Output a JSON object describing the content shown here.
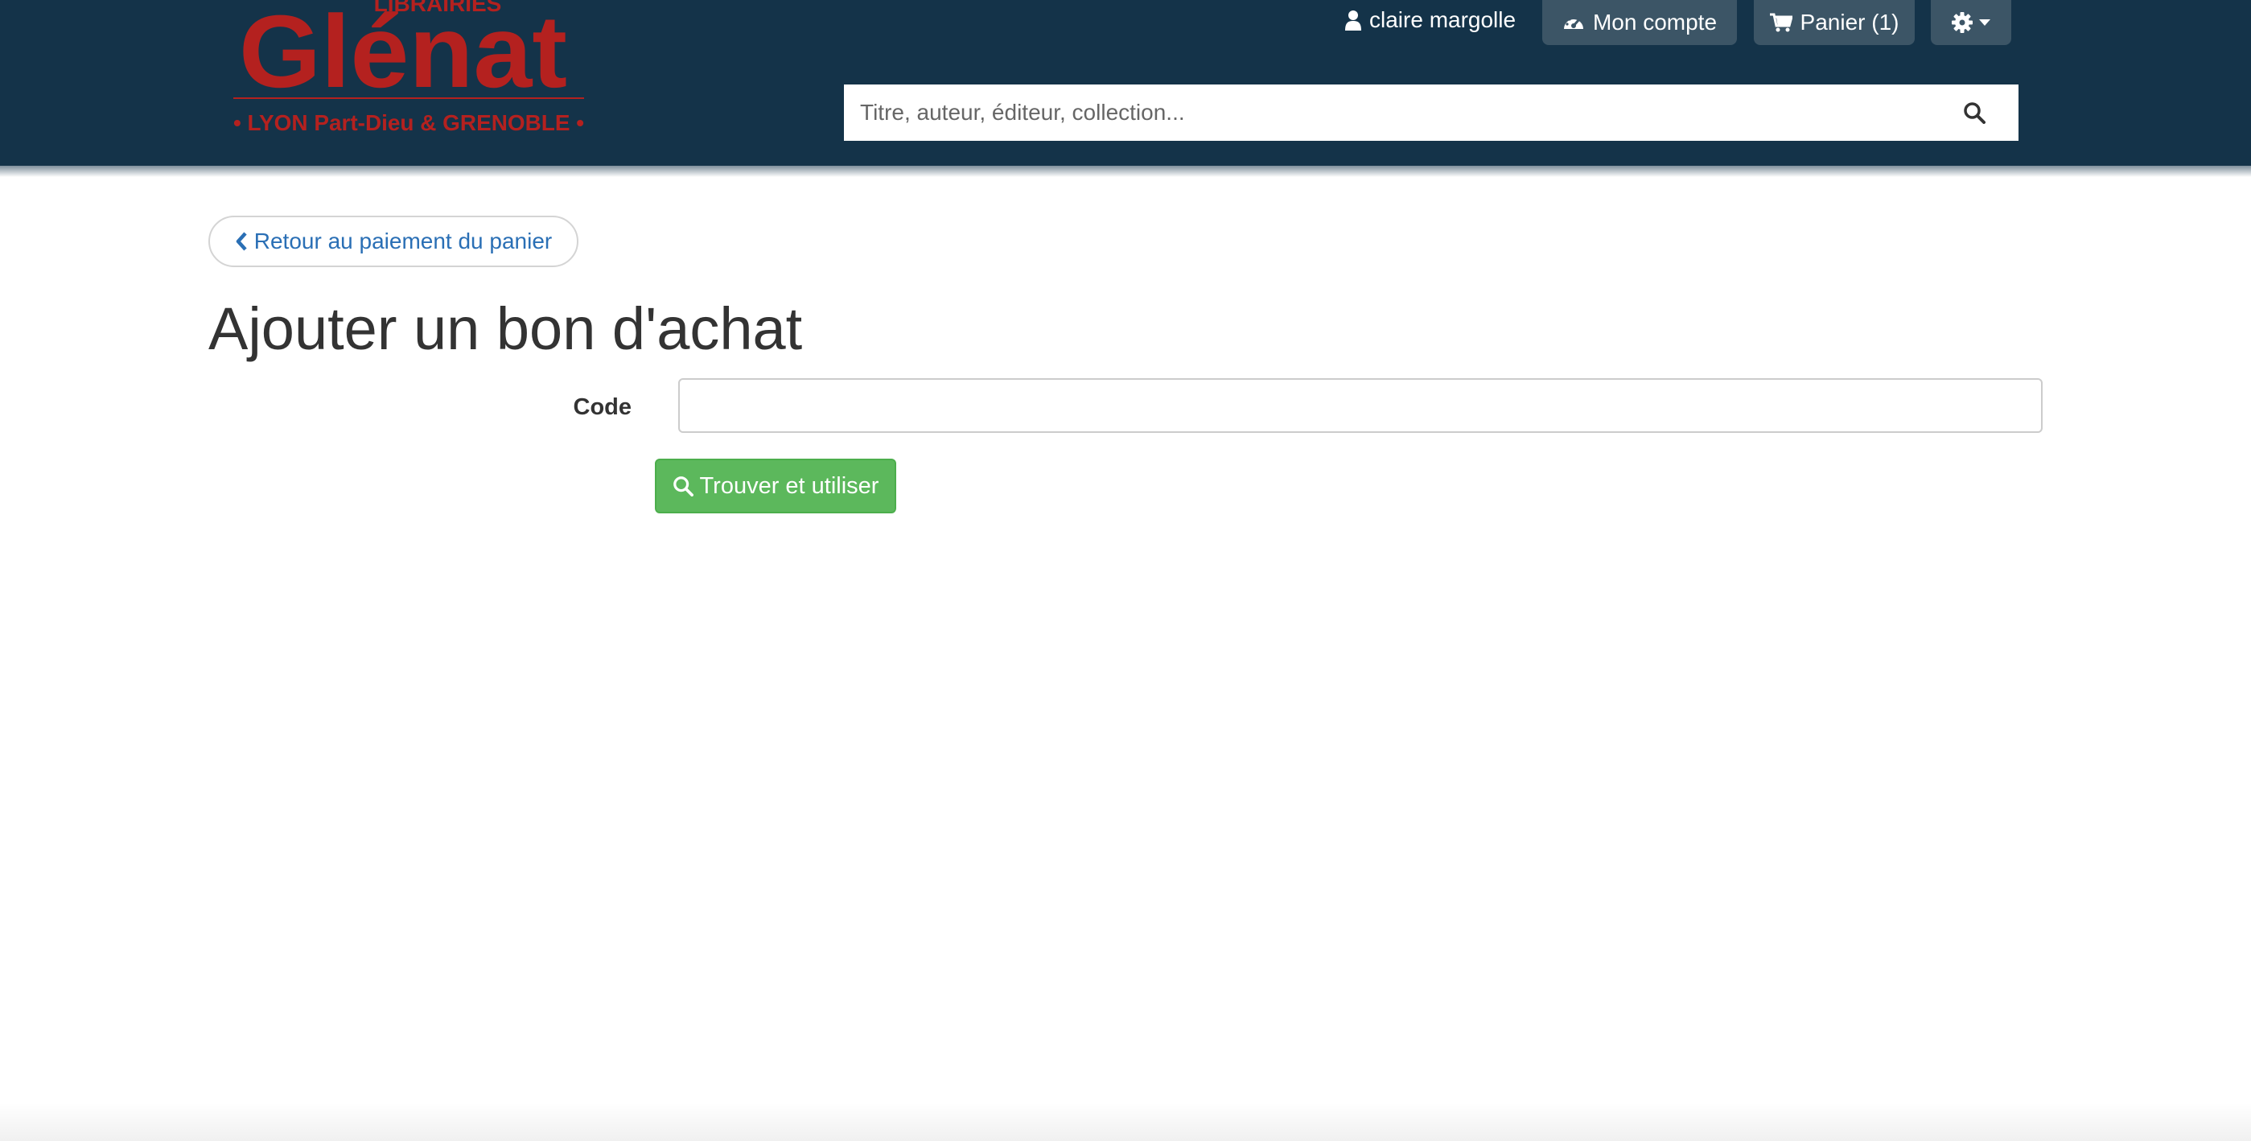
{
  "header": {
    "logo": {
      "top_text": "LIBRAIRIES",
      "brand": "Glénat",
      "subtitle": "• LYON Part-Dieu & GRENOBLE •",
      "color": "#b4211f"
    },
    "user_name": "claire margolle",
    "account_label": "Mon compte",
    "cart_label": "Panier (1)",
    "search": {
      "placeholder": "Titre, auteur, éditeur, collection..."
    },
    "icons": {
      "user": "user-icon",
      "account": "dashboard-icon",
      "cart": "cart-icon",
      "settings": "gear-icon",
      "caret": "caret-down-icon",
      "search": "search-icon"
    },
    "background_color": "#143349"
  },
  "main": {
    "back_label": "Retour au paiement du panier",
    "title": "Ajouter un bon d'achat",
    "form": {
      "code_label": "Code",
      "code_value": "",
      "submit_label": "Trouver et utiliser"
    },
    "colors": {
      "link": "#2a6fb5",
      "success": "#5cb85c"
    }
  }
}
